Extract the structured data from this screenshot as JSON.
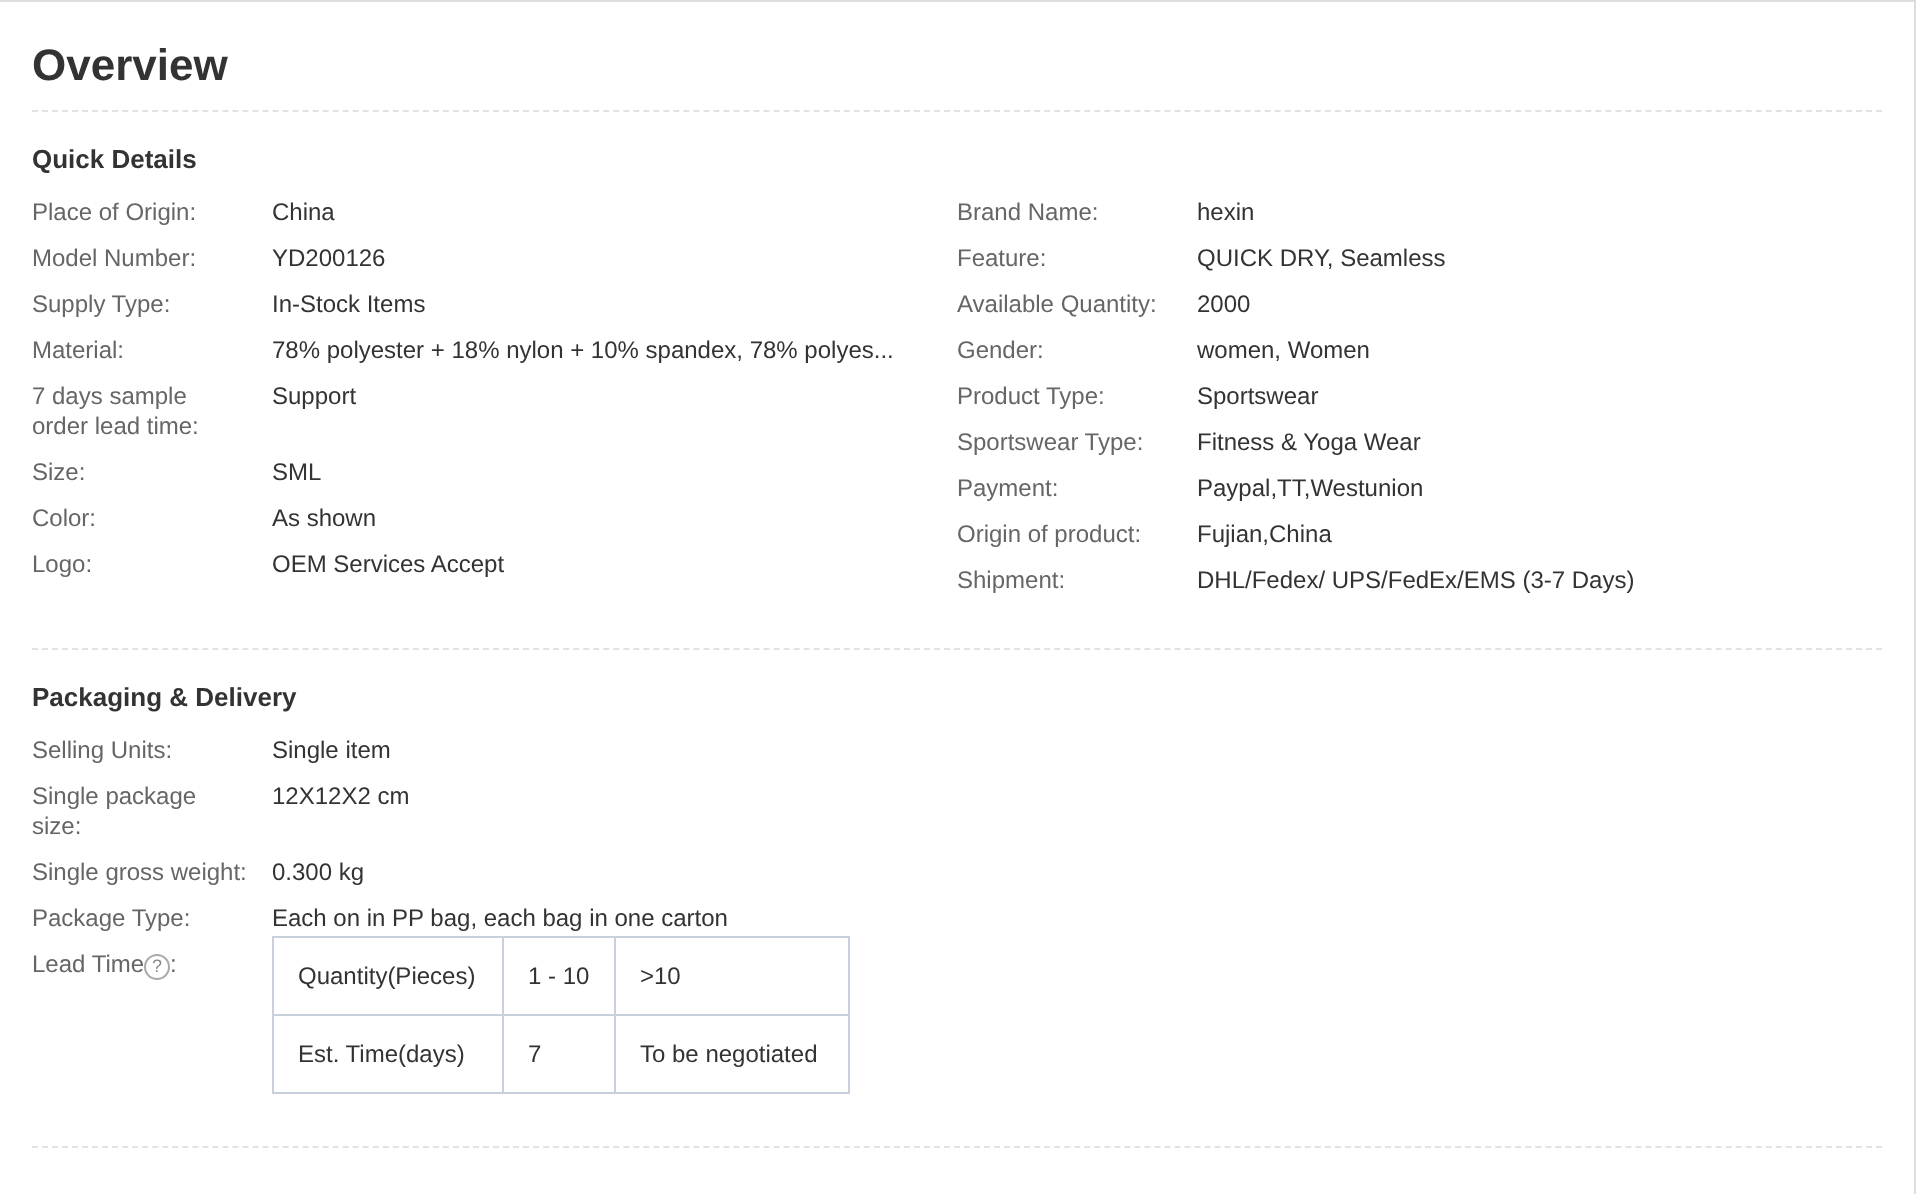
{
  "title": "Overview",
  "quick_details": {
    "heading": "Quick Details",
    "left": [
      {
        "label": "Place of Origin:",
        "value": "China"
      },
      {
        "label": "Model Number:",
        "value": "YD200126"
      },
      {
        "label": "Supply Type:",
        "value": "In-Stock Items"
      },
      {
        "label": "Material:",
        "value": "78% polyester + 18% nylon + 10% spandex, 78% polyes..."
      },
      {
        "label": "7 days sample order lead time:",
        "value": "Support"
      },
      {
        "label": "Size:",
        "value": "SML"
      },
      {
        "label": "Color:",
        "value": "As shown"
      },
      {
        "label": "Logo:",
        "value": "OEM Services Accept"
      }
    ],
    "right": [
      {
        "label": "Brand Name:",
        "value": "hexin"
      },
      {
        "label": "Feature:",
        "value": "QUICK DRY, Seamless"
      },
      {
        "label": "Available Quantity:",
        "value": "2000"
      },
      {
        "label": "Gender:",
        "value": "women, Women"
      },
      {
        "label": "Product Type:",
        "value": "Sportswear"
      },
      {
        "label": "Sportswear Type:",
        "value": "Fitness & Yoga Wear"
      },
      {
        "label": "Payment:",
        "value": "Paypal,TT,Westunion"
      },
      {
        "label": "Origin of product:",
        "value": "Fujian,China"
      },
      {
        "label": "Shipment:",
        "value": "DHL/Fedex/ UPS/FedEx/EMS (3-7 Days)"
      }
    ]
  },
  "packaging": {
    "heading": "Packaging & Delivery",
    "rows": [
      {
        "label": "Selling Units:",
        "value": "Single item"
      },
      {
        "label": "Single package size:",
        "value": "12X12X2 cm"
      },
      {
        "label": "Single gross weight:",
        "value": "0.300 kg"
      },
      {
        "label": "Package Type:",
        "value": "Each on in PP bag, each bag in one carton"
      }
    ],
    "lead_time": {
      "label": "Lead Time",
      "help_mark": "?",
      "colon": ":",
      "table": [
        [
          "Quantity(Pieces)",
          "1 - 10",
          ">10"
        ],
        [
          "Est. Time(days)",
          "7",
          "To be negotiated"
        ]
      ]
    }
  }
}
